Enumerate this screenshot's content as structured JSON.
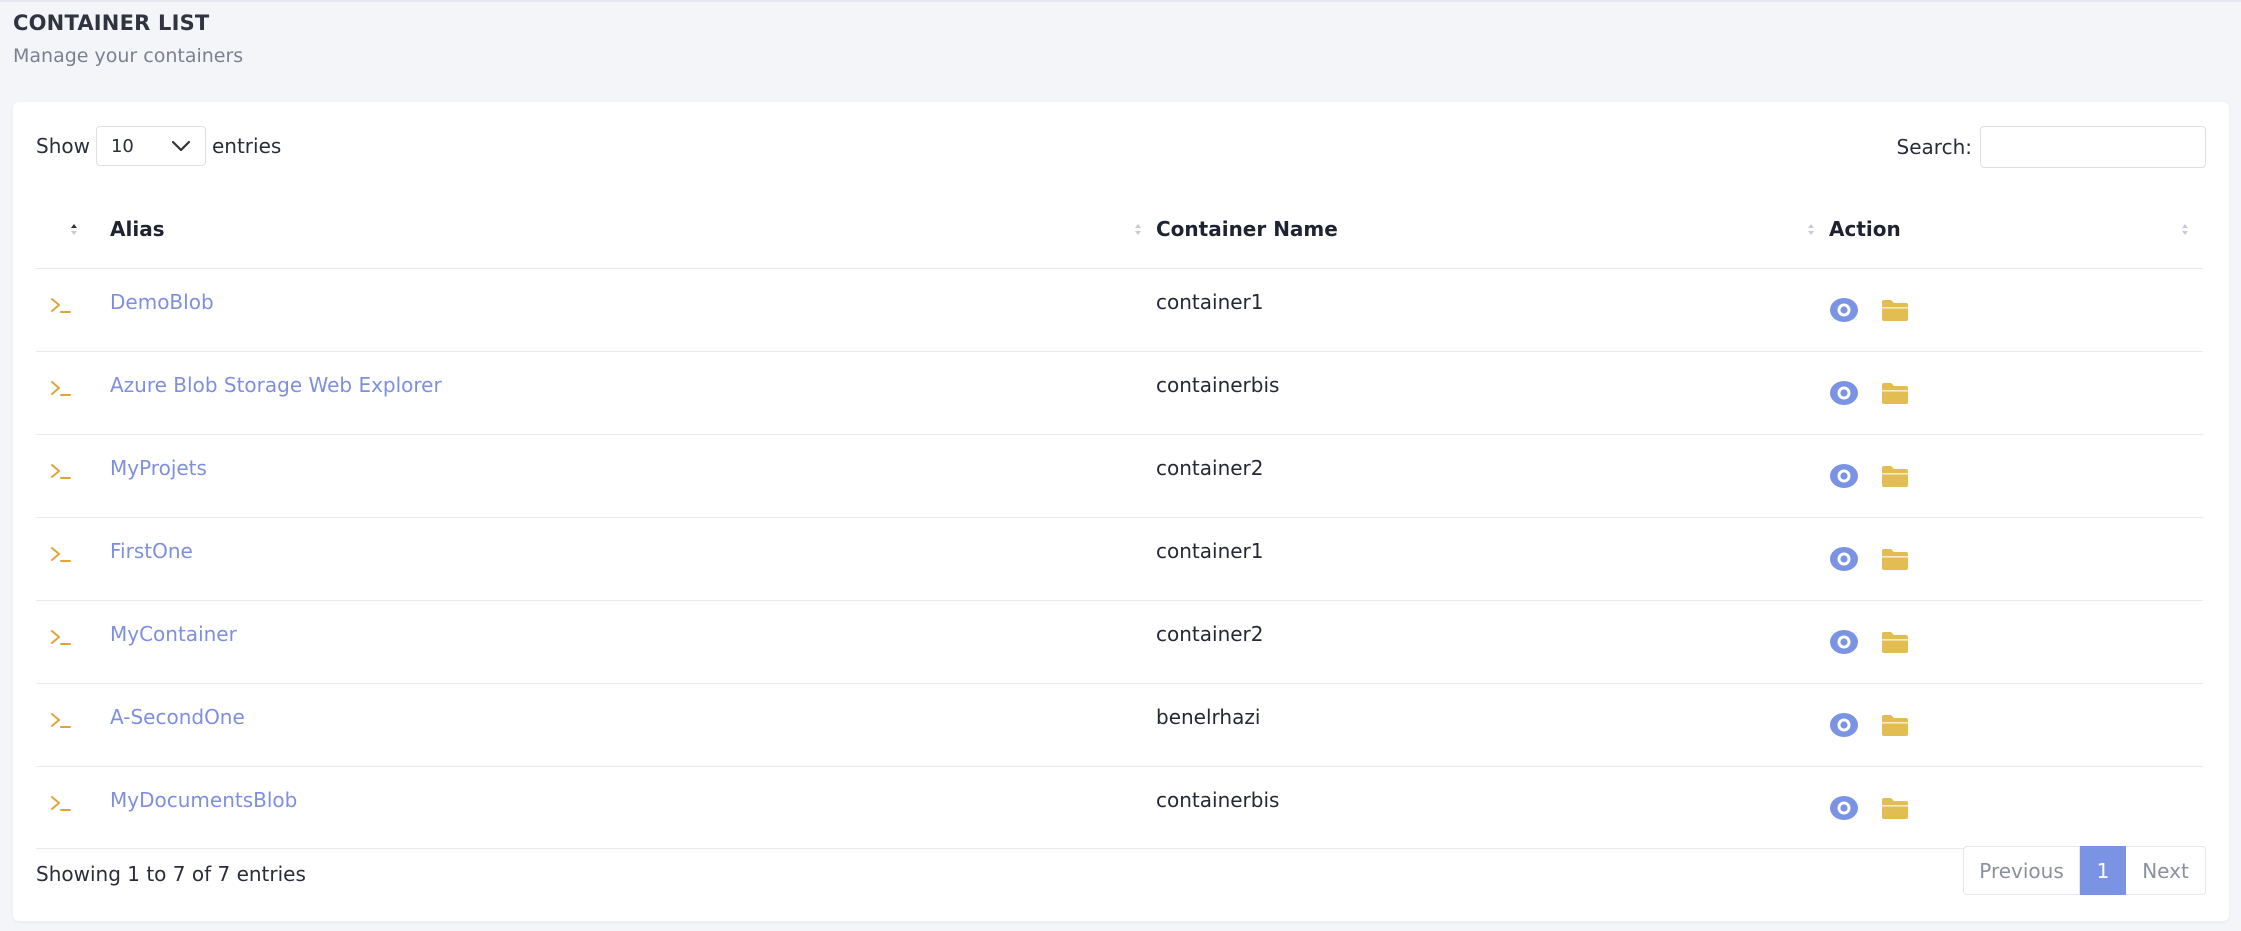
{
  "header": {
    "title": "CONTAINER LIST",
    "subtitle": "Manage your containers"
  },
  "controls": {
    "show_label": "Show",
    "entries_value": "10",
    "entries_label": "entries",
    "search_label": "Search:",
    "search_value": ""
  },
  "table": {
    "columns": [
      "",
      "Alias",
      "Container Name",
      "Action"
    ],
    "rows": [
      {
        "alias": "DemoBlob",
        "container_name": "container1"
      },
      {
        "alias": "Azure Blob Storage Web Explorer",
        "container_name": "containerbis"
      },
      {
        "alias": "MyProjets",
        "container_name": "container2"
      },
      {
        "alias": "FirstOne",
        "container_name": "container1"
      },
      {
        "alias": "MyContainer",
        "container_name": "container2"
      },
      {
        "alias": "A-SecondOne",
        "container_name": "benelrhazi"
      },
      {
        "alias": "MyDocumentsBlob",
        "container_name": "containerbis"
      }
    ],
    "row_icons": {
      "prompt": "terminal-prompt-icon",
      "view": "eye-icon",
      "open": "folder-icon"
    }
  },
  "footer": {
    "info": "Showing 1 to 7 of 7 entries",
    "previous": "Previous",
    "page": "1",
    "next": "Next"
  },
  "colors": {
    "link": "#7f8fe0",
    "prompt_icon": "#e0a43a",
    "eye_icon": "#7b93e3",
    "folder_icon": "#e2bd52",
    "active_page": "#7b93e3",
    "background": "#f4f5f9"
  }
}
